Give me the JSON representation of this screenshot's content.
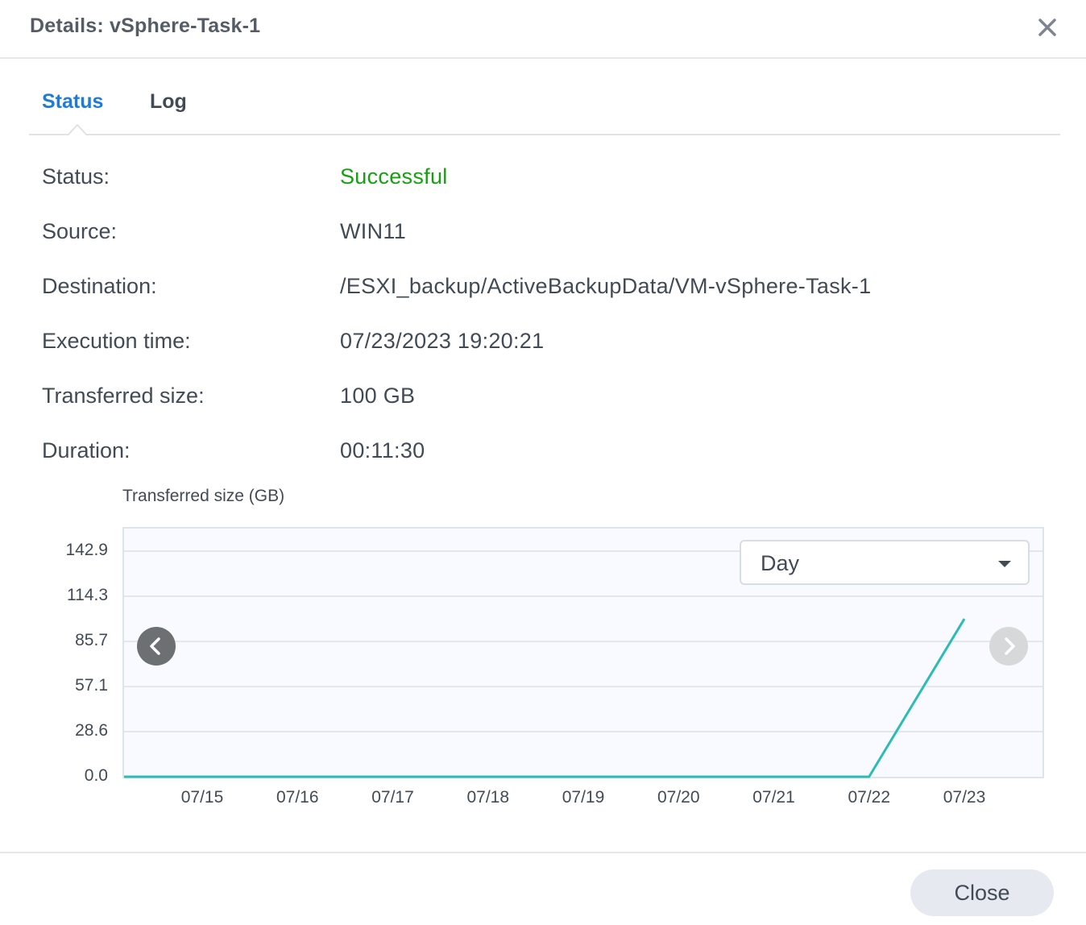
{
  "dialog": {
    "title": "Details: vSphere-Task-1"
  },
  "tabs": [
    {
      "label": "Status",
      "active": true
    },
    {
      "label": "Log",
      "active": false
    }
  ],
  "details": {
    "status_label": "Status:",
    "status_value": "Successful",
    "source_label": "Source:",
    "source_value": "WIN11",
    "destination_label": "Destination:",
    "destination_value": "/ESXI_backup/ActiveBackupData/VM-vSphere-Task-1",
    "execution_label": "Execution time:",
    "execution_value": "07/23/2023 19:20:21",
    "transferred_label": "Transferred size:",
    "transferred_value": "100 GB",
    "duration_label": "Duration:",
    "duration_value": "00:11:30"
  },
  "range_select": {
    "selected": "Day"
  },
  "footer": {
    "close_label": "Close"
  },
  "colors": {
    "accent": "#1f7bd9",
    "success": "#13a10e",
    "series": "#2bbdb5"
  },
  "icons": {
    "close": "close-icon",
    "dropdown": "caret-down-icon",
    "prev": "chevron-left-icon",
    "next": "chevron-right-icon"
  },
  "chart_data": {
    "type": "line",
    "ylabel": "Transferred size (GB)",
    "ylim": [
      0,
      142.9
    ],
    "yticks": [
      "142.9",
      "114.3",
      "85.7",
      "57.1",
      "28.6",
      "0.0"
    ],
    "x": [
      "07/15",
      "07/16",
      "07/17",
      "07/18",
      "07/19",
      "07/20",
      "07/21",
      "07/22",
      "07/23"
    ],
    "series": [
      {
        "values": [
          0,
          0,
          0,
          0,
          0,
          0,
          0,
          0,
          100
        ]
      }
    ],
    "grid": true
  }
}
